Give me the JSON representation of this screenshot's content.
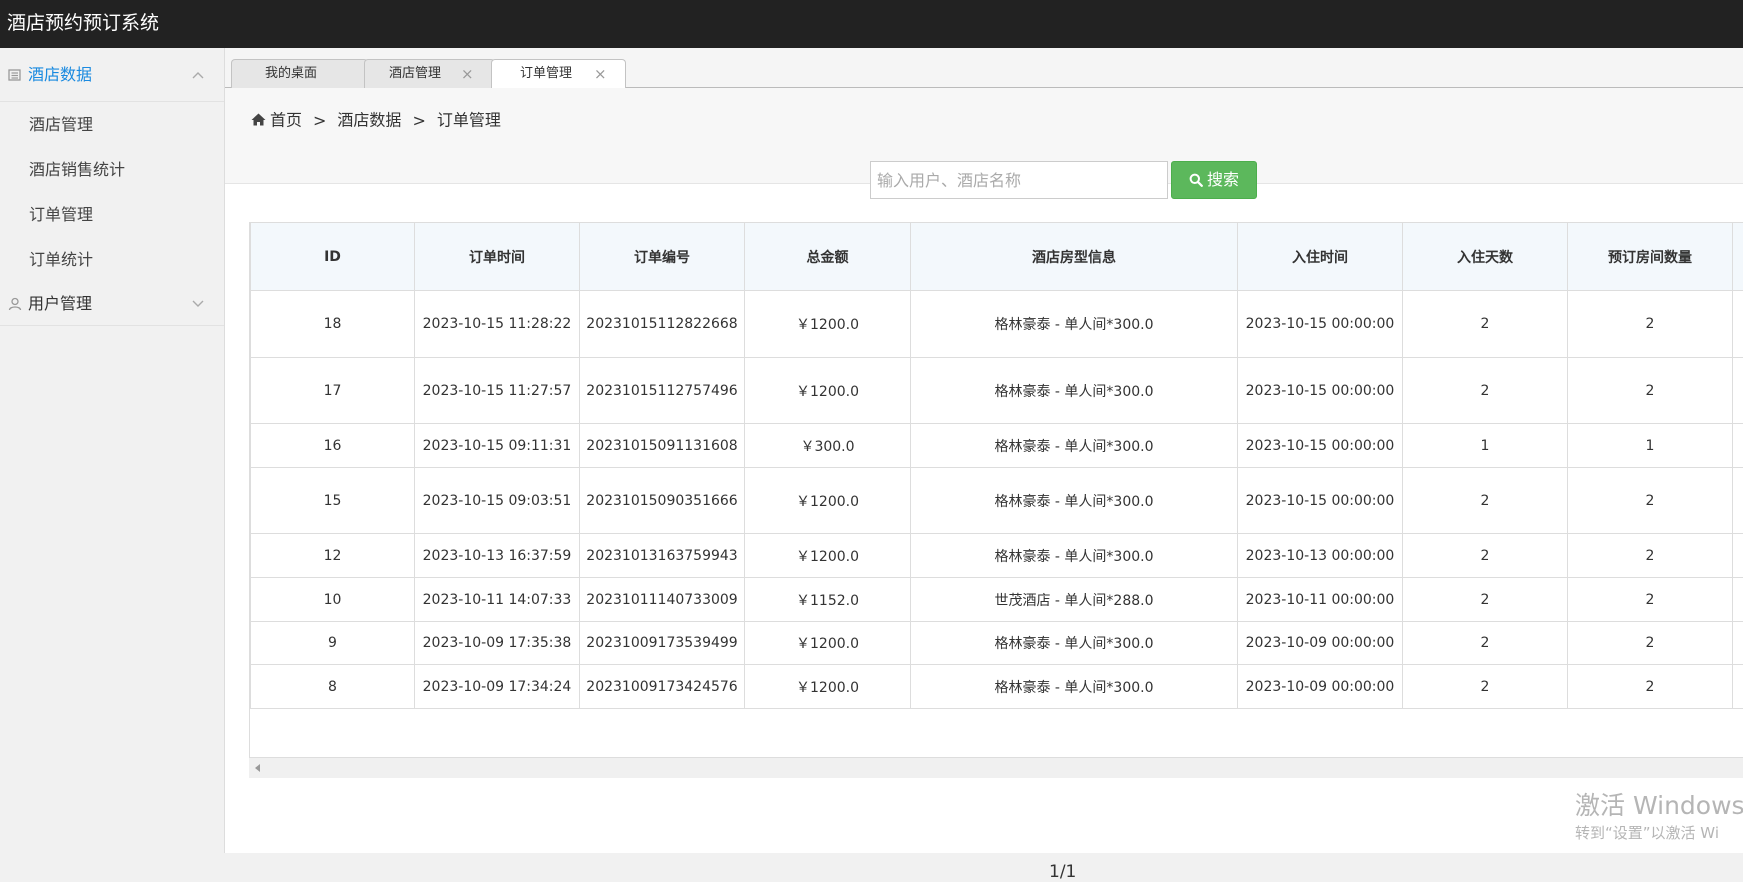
{
  "app": {
    "title": "酒店预约预订系统"
  },
  "sidebar": {
    "groups": [
      {
        "label": "酒店数据",
        "expanded": true,
        "items": [
          "酒店管理",
          "酒店销售统计",
          "订单管理",
          "订单统计"
        ]
      },
      {
        "label": "用户管理",
        "expanded": false,
        "items": []
      }
    ]
  },
  "tabs": [
    {
      "label": "我的桌面",
      "closable": false
    },
    {
      "label": "酒店管理",
      "closable": true
    },
    {
      "label": "订单管理",
      "closable": true,
      "active": true
    }
  ],
  "tab_close_glyph": "×",
  "breadcrumb": {
    "home": "首页",
    "separator": ">",
    "items": [
      "酒店数据",
      "订单管理"
    ]
  },
  "search": {
    "placeholder": "输入用户、酒店名称",
    "value": "",
    "button_label": "搜索"
  },
  "table": {
    "columns": [
      "ID",
      "订单时间",
      "订单编号",
      "总金额",
      "酒店房型信息",
      "入住时间",
      "入住天数",
      "预订房间数量"
    ],
    "rows": [
      [
        "18",
        "2023-10-15 11:28:22",
        "20231015112822668",
        "￥1200.0",
        "格林豪泰 - 单人间*300.0",
        "2023-10-15 00:00:00",
        "2",
        "2"
      ],
      [
        "17",
        "2023-10-15 11:27:57",
        "20231015112757496",
        "￥1200.0",
        "格林豪泰 - 单人间*300.0",
        "2023-10-15 00:00:00",
        "2",
        "2"
      ],
      [
        "16",
        "2023-10-15 09:11:31",
        "20231015091131608",
        "￥300.0",
        "格林豪泰 - 单人间*300.0",
        "2023-10-15 00:00:00",
        "1",
        "1"
      ],
      [
        "15",
        "2023-10-15 09:03:51",
        "20231015090351666",
        "￥1200.0",
        "格林豪泰 - 单人间*300.0",
        "2023-10-15 00:00:00",
        "2",
        "2"
      ],
      [
        "12",
        "2023-10-13 16:37:59",
        "20231013163759943",
        "￥1200.0",
        "格林豪泰 - 单人间*300.0",
        "2023-10-13 00:00:00",
        "2",
        "2"
      ],
      [
        "10",
        "2023-10-11 14:07:33",
        "20231011140733009",
        "￥1152.0",
        "世茂酒店 - 单人间*288.0",
        "2023-10-11 00:00:00",
        "2",
        "2"
      ],
      [
        "9",
        "2023-10-09 17:35:38",
        "20231009173539499",
        "￥1200.0",
        "格林豪泰 - 单人间*300.0",
        "2023-10-09 00:00:00",
        "2",
        "2"
      ],
      [
        "8",
        "2023-10-09 17:34:24",
        "20231009173424576",
        "￥1200.0",
        "格林豪泰 - 单人间*300.0",
        "2023-10-09 00:00:00",
        "2",
        "2"
      ]
    ]
  },
  "pagination": {
    "text": "1/1"
  },
  "watermark": {
    "line1": "激活 Windows",
    "line2": "转到“设置”以激活 Wi"
  },
  "colors": {
    "topbar": "#222222",
    "accent": "#1a8ae0",
    "search_button": "#5cb85c",
    "header_bg": "#f3f8fc"
  }
}
